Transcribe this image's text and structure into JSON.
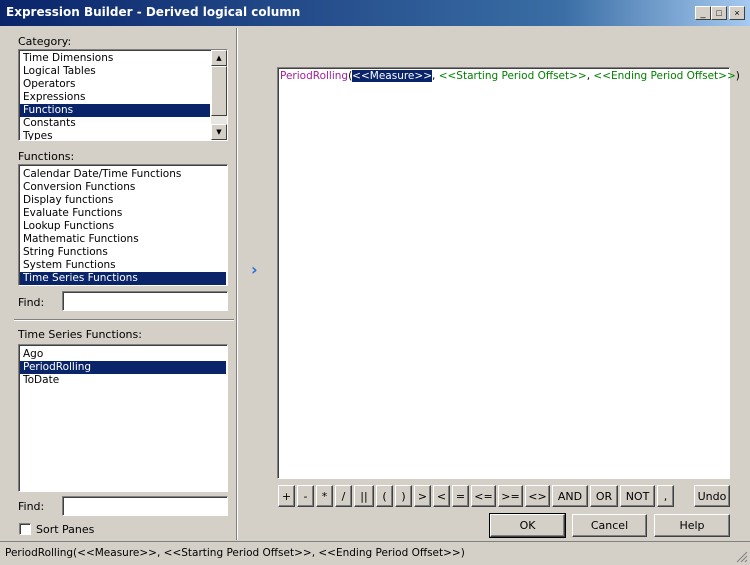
{
  "window": {
    "title": "Expression Builder - Derived logical column",
    "minimize": "_",
    "maximize": "□",
    "close": "×"
  },
  "category": {
    "label": "Category:",
    "items": [
      "Time Dimensions",
      "Logical Tables",
      "Operators",
      "Expressions",
      "Functions",
      "Constants",
      "Types"
    ],
    "selected_index": 4
  },
  "functions": {
    "label": "Functions:",
    "items": [
      "Calendar Date/Time Functions",
      "Conversion Functions",
      "Display functions",
      "Evaluate Functions",
      "Lookup Functions",
      "Mathematic Functions",
      "String Functions",
      "System Functions",
      "Time Series Functions"
    ],
    "selected_index": 8,
    "find_label": "Find:",
    "find_value": ""
  },
  "subfunctions": {
    "label": "Time Series Functions:",
    "items": [
      "Ago",
      "PeriodRolling",
      "ToDate"
    ],
    "selected_index": 1,
    "find_label": "Find:",
    "find_value": ""
  },
  "sort_panes": {
    "label": "Sort Panes",
    "checked": false
  },
  "insert_arrow": "›",
  "expression": {
    "function_name": "PeriodRolling",
    "open_paren": "(",
    "selected_arg": "<<Measure>>",
    "sep1": ", ",
    "arg2": "<<Starting Period Offset>>",
    "sep2": ", ",
    "arg3": "<<Ending Period Offset>>",
    "close_paren": ")"
  },
  "operators": [
    "+",
    "-",
    "*",
    "/",
    "||",
    "(",
    ")",
    ">",
    "<",
    "=",
    "<=",
    ">=",
    "<>",
    "AND",
    "OR",
    "NOT",
    ","
  ],
  "undo_label": "Undo",
  "dialog_buttons": {
    "ok": "OK",
    "cancel": "Cancel",
    "help": "Help"
  },
  "status": {
    "text": "PeriodRolling(<<Measure>>, <<Starting Period Offset>>, <<Ending Period Offset>>)"
  },
  "colors": {
    "title_start": "#0a246a",
    "title_end": "#a6caf0",
    "selection": "#0a246a",
    "function_name": "#a020a0",
    "argument": "#008000",
    "face": "#d4d0c8"
  }
}
